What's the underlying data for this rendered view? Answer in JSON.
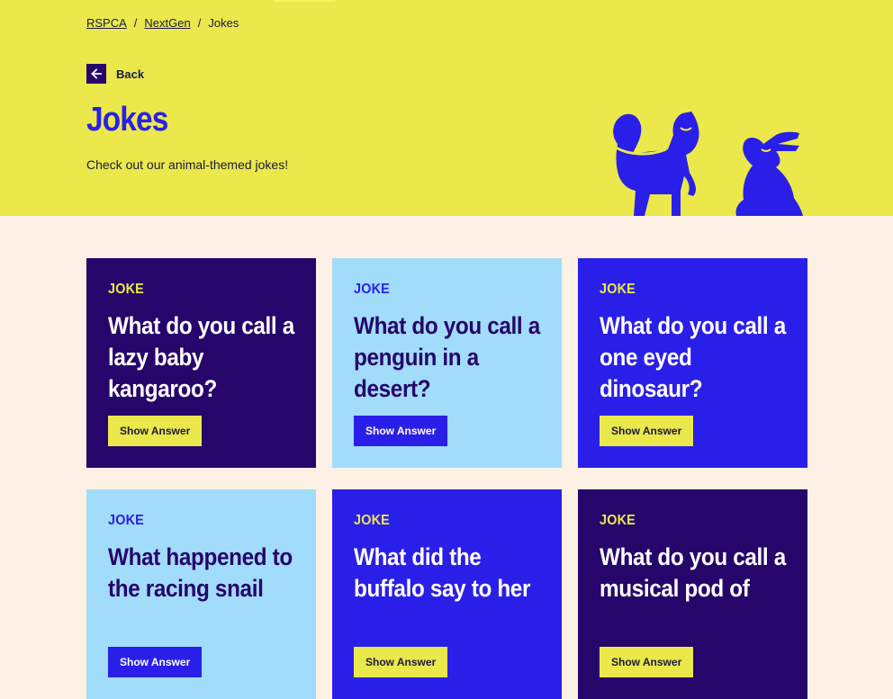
{
  "breadcrumb": {
    "items": [
      "RSPCA",
      "NextGen"
    ],
    "current": "Jokes",
    "separator": "/"
  },
  "back": {
    "label": "Back"
  },
  "header": {
    "title": "Jokes",
    "subtitle": "Check out our animal-themed jokes!"
  },
  "colors": {
    "hero_bg": "#ebe84b",
    "page_bg": "#fdf0e4",
    "dark_purple": "#26066b",
    "light_blue": "#a2dcfb",
    "bright_blue": "#2a1fe8",
    "yellow": "#ebe84b"
  },
  "cards": [
    {
      "tag": "JOKE",
      "question": "What do you call a lazy baby kangaroo?",
      "button": "Show Answer",
      "theme": "dark"
    },
    {
      "tag": "JOKE",
      "question": "What do you call a penguin in a desert?",
      "button": "Show Answer",
      "theme": "light"
    },
    {
      "tag": "JOKE",
      "question": "What do you call a one eyed dinosaur?",
      "button": "Show Answer",
      "theme": "blue"
    },
    {
      "tag": "JOKE",
      "question": "What happened to the racing snail",
      "button": "Show Answer",
      "theme": "light"
    },
    {
      "tag": "JOKE",
      "question": "What did the buffalo say to her",
      "button": "Show Answer",
      "theme": "blue"
    },
    {
      "tag": "JOKE",
      "question": "What do you call a musical pod of",
      "button": "Show Answer",
      "theme": "dark"
    }
  ]
}
